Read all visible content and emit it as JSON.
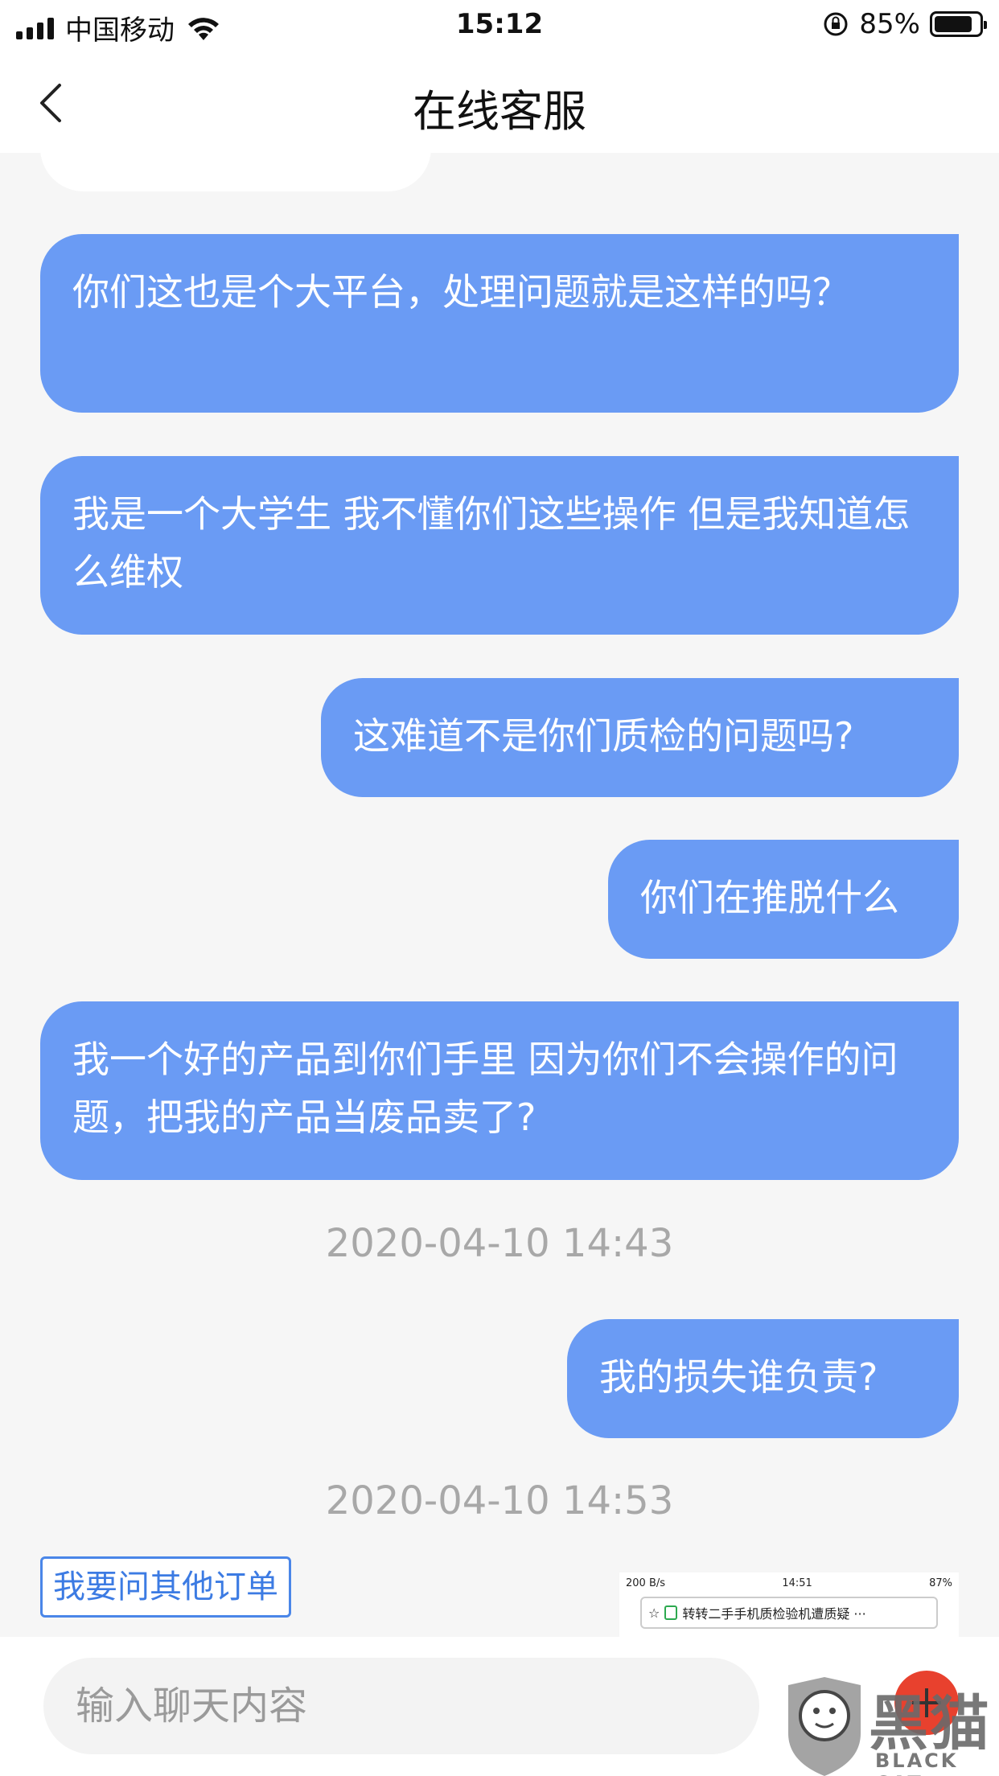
{
  "status_bar": {
    "carrier": "中国移动",
    "time": "15:12",
    "battery_percent": "85%",
    "battery_level": 0.85
  },
  "header": {
    "title": "在线客服",
    "back_icon": "chevron-left-icon"
  },
  "messages": [
    {
      "type": "bubble",
      "text": "你们这也是个大平台，处理问题就是这样的吗？"
    },
    {
      "type": "bubble",
      "text": "我是一个大学生 我不懂你们这些操作 但是我知道怎么维权"
    },
    {
      "type": "bubble",
      "text": "这难道不是你们质检的问题吗?"
    },
    {
      "type": "bubble",
      "text": "你们在推脱什么"
    },
    {
      "type": "bubble",
      "text": "我一个好的产品到你们手里 因为你们不会操作的问题，把我的产品当废品卖了?"
    },
    {
      "type": "timestamp",
      "text": "2020-04-10 14:43"
    },
    {
      "type": "bubble",
      "text": "我的损失谁负责?"
    },
    {
      "type": "timestamp",
      "text": "2020-04-10 14:53"
    }
  ],
  "quick_reply": {
    "label": "我要问其他订单"
  },
  "image_preview": {
    "status_left": "200 B/s",
    "status_time": "14:51",
    "status_battery": "87%",
    "url_text": "转转二手手机质检验机遭质疑 ···"
  },
  "input": {
    "placeholder": "输入聊天内容"
  },
  "watermark": {
    "big": "黑猫",
    "small": "BLACK CAT"
  },
  "colors": {
    "bubble": "#6a9bf4",
    "accent": "#4a86e8",
    "plus": "#e8412e"
  }
}
